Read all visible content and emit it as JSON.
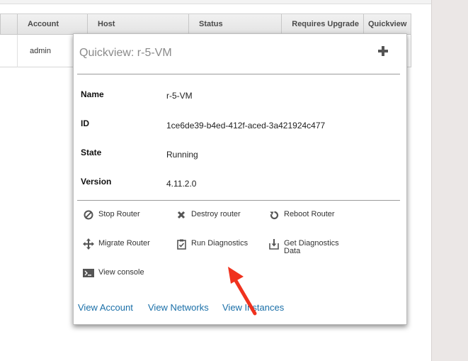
{
  "table": {
    "headers": [
      "Account",
      "Host",
      "Status",
      "Requires Upgrade",
      "Quickview"
    ],
    "row": {
      "account": "admin"
    }
  },
  "quickview": {
    "title": "Quickview: r-5-VM",
    "details": [
      {
        "label": "Name",
        "value": "r-5-VM"
      },
      {
        "label": "ID",
        "value": "1ce6de39-b4ed-412f-aced-3a421924c477"
      },
      {
        "label": "State",
        "value": "Running"
      },
      {
        "label": "Version",
        "value": "4.11.2.0"
      }
    ],
    "actions": {
      "stop": "Stop Router",
      "destroy": "Destroy router",
      "reboot": "Reboot Router",
      "migrate": "Migrate Router",
      "diagnostics": "Run Diagnostics",
      "get_diag_line1": "Get Diagnostics",
      "get_diag_line2": "Data",
      "console": "View console"
    },
    "links": {
      "account": "View Account",
      "networks": "View Networks",
      "instances": "View Instances"
    }
  },
  "colors": {
    "link": "#1a6fa8",
    "arrow": "#f0321e",
    "gutter": "#ebe7e6"
  }
}
